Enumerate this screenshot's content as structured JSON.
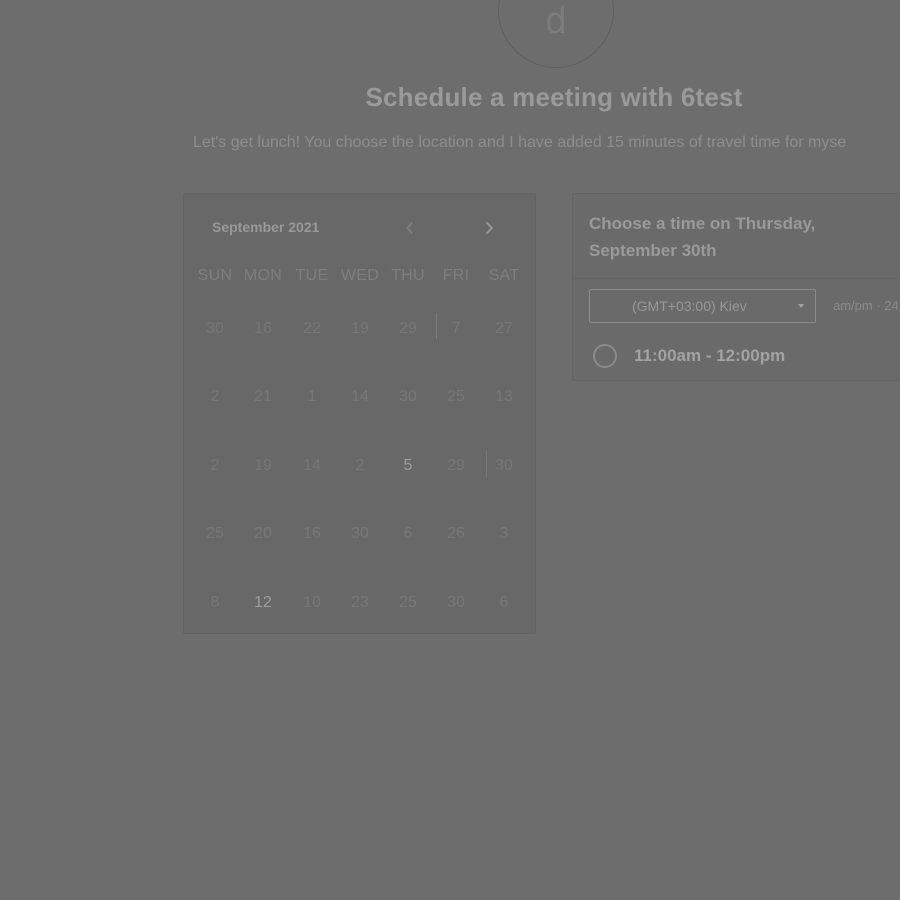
{
  "profile": {
    "avatar_letter": "d"
  },
  "header": {
    "title": "Schedule a meeting with 6test",
    "description": "Let's get lunch! You choose the location and I have added 15 minutes of travel time for myse"
  },
  "calendar": {
    "month_label": "September 2021",
    "prev_icon": "chevron-left-icon",
    "next_icon": "chevron-right-icon",
    "weekdays": [
      "SUN",
      "MON",
      "TUE",
      "WED",
      "THU",
      "FRI",
      "SAT"
    ],
    "weeks": [
      [
        "30",
        "16",
        "22",
        "19",
        "29",
        "7",
        "27"
      ],
      [
        "2",
        "21",
        "1",
        "14",
        "30",
        "25",
        "13"
      ],
      [
        "2",
        "19",
        "14",
        "2",
        "5",
        "29",
        "30"
      ],
      [
        "25",
        "20",
        "16",
        "30",
        "6",
        "26",
        "3"
      ],
      [
        "8",
        "12",
        "10",
        "23",
        "25",
        "30",
        "6"
      ]
    ],
    "highlighted": [
      [
        2,
        4
      ],
      [
        4,
        1
      ]
    ]
  },
  "times": {
    "heading": "Choose a time on Thursday, September 30th",
    "timezone": "(GMT+03:00) Kiev",
    "format_toggle": "am/pm · 24",
    "slots": [
      {
        "label": "11:00am - 12:00pm"
      }
    ]
  },
  "colors": {
    "overlay_bg": "#6d6d6d",
    "card_bg": "#686868",
    "text_muted": "#777777",
    "text_strong": "#9a9a9a"
  }
}
